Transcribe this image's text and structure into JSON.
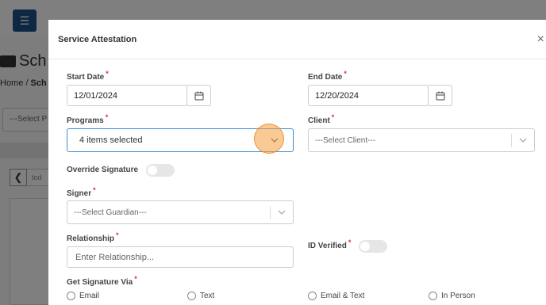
{
  "background": {
    "heading_fragment": "Sch",
    "breadcrumb_home": "Home",
    "breadcrumb_sep": "/",
    "breadcrumb_current": "Sch",
    "select_fragment": "---Select P",
    "today_fragment": "tod"
  },
  "modal": {
    "title": "Service Attestation",
    "close_symbol": "×",
    "start_date": {
      "label": "Start Date",
      "value": "12/01/2024"
    },
    "end_date": {
      "label": "End Date",
      "value": "12/20/2024"
    },
    "programs": {
      "label": "Programs",
      "value": "4 items selected"
    },
    "client": {
      "label": "Client",
      "placeholder": "---Select Client---"
    },
    "override_signature": {
      "label": "Override Signature",
      "enabled": false
    },
    "signer": {
      "label": "Signer",
      "placeholder": "---Select Guardian---"
    },
    "relationship": {
      "label": "Relationship",
      "placeholder": "Enter Relationship..."
    },
    "id_verified": {
      "label": "ID Verified",
      "enabled": false
    },
    "signature_via": {
      "label": "Get Signature Via",
      "options": [
        "Email",
        "Text",
        "Email & Text",
        "In Person"
      ]
    },
    "required_marker": "*"
  },
  "colors": {
    "accent": "#3a8fd9",
    "required": "#e03131",
    "menu_button": "#1d4e89"
  }
}
